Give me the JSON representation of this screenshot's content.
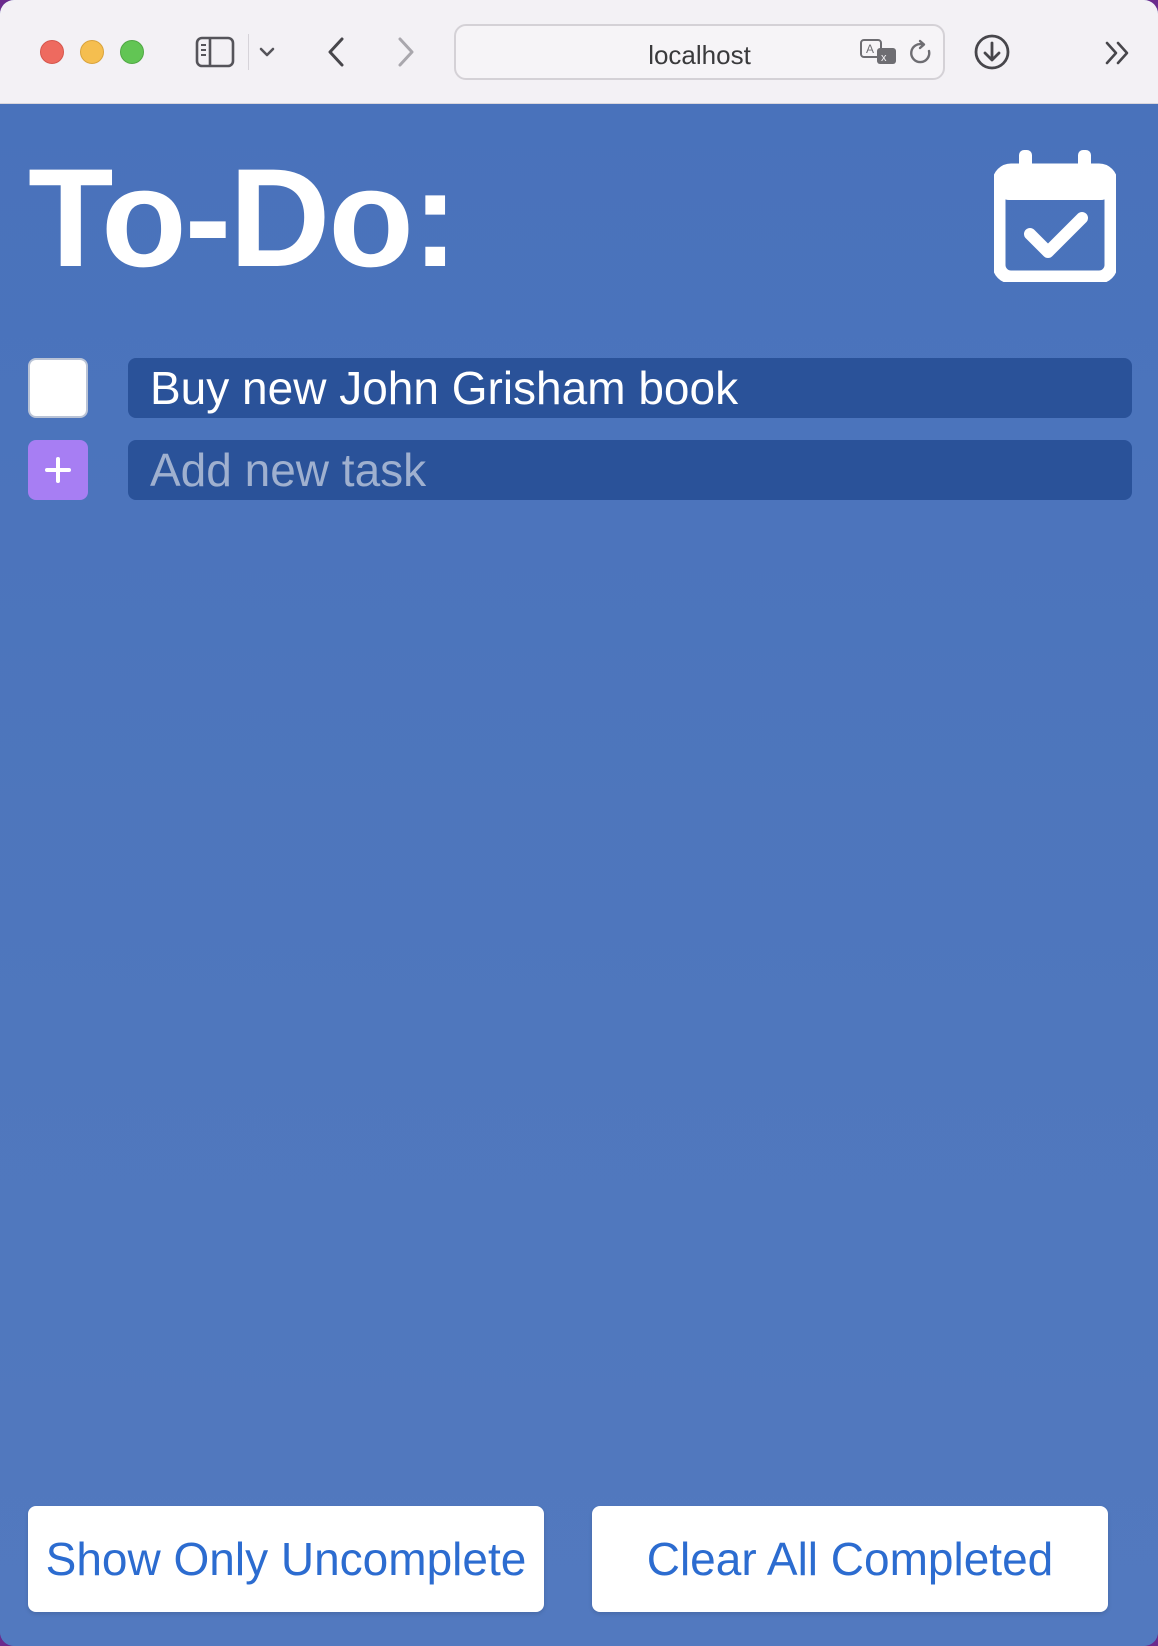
{
  "browser": {
    "address": "localhost",
    "icons": {
      "sidebar": "sidebar-icon",
      "sidebar_menu": "chevron-down-icon",
      "back": "chevron-left-icon",
      "forward": "chevron-right-icon",
      "translate": "translate-icon",
      "reload": "reload-icon",
      "downloads": "download-icon",
      "more": "double-chevron-right-icon"
    }
  },
  "app": {
    "title": "To-Do:",
    "header_icon": "calendar-check-icon",
    "tasks": [
      {
        "text": "Buy new John Grisham book",
        "completed": false
      }
    ],
    "new_task": {
      "placeholder": "Add new task",
      "value": ""
    },
    "buttons": {
      "show_uncomplete": "Show Only Uncomplete",
      "clear_completed": "Clear All Completed"
    },
    "colors": {
      "background": "#4a73bc",
      "field": "#2a5299",
      "add_button": "#a77ef3",
      "button_text": "#2c6cd0"
    }
  }
}
